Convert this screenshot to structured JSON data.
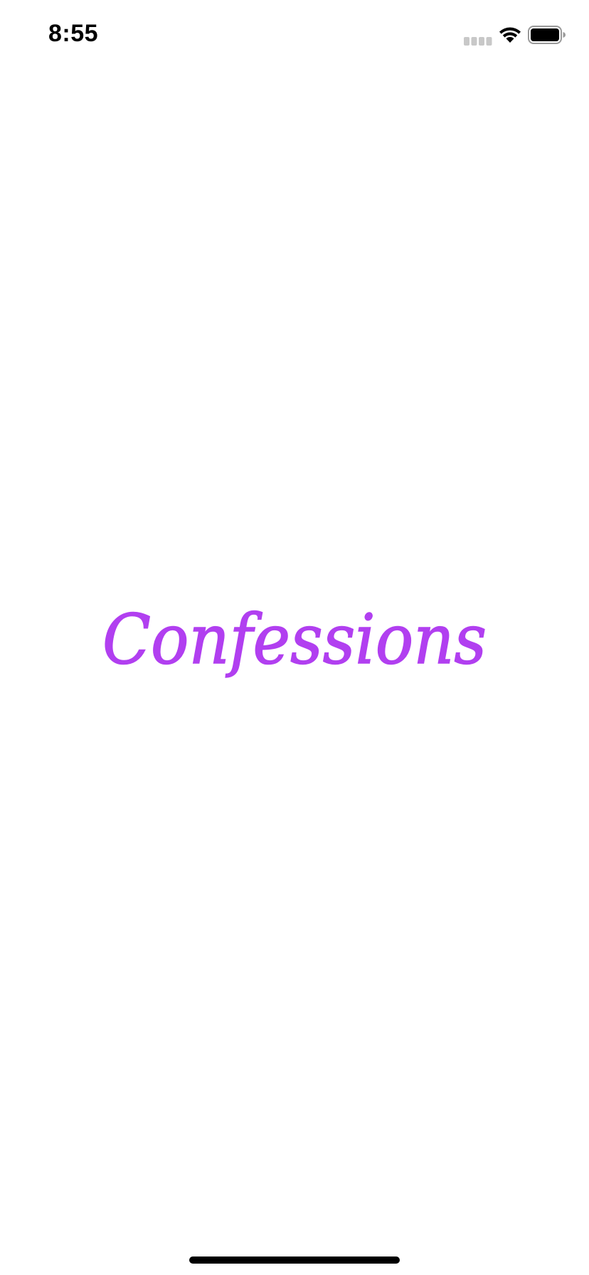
{
  "status_bar": {
    "time": "8:55"
  },
  "splash": {
    "app_name": "Confessions",
    "brand_color": "#b13ff0"
  }
}
